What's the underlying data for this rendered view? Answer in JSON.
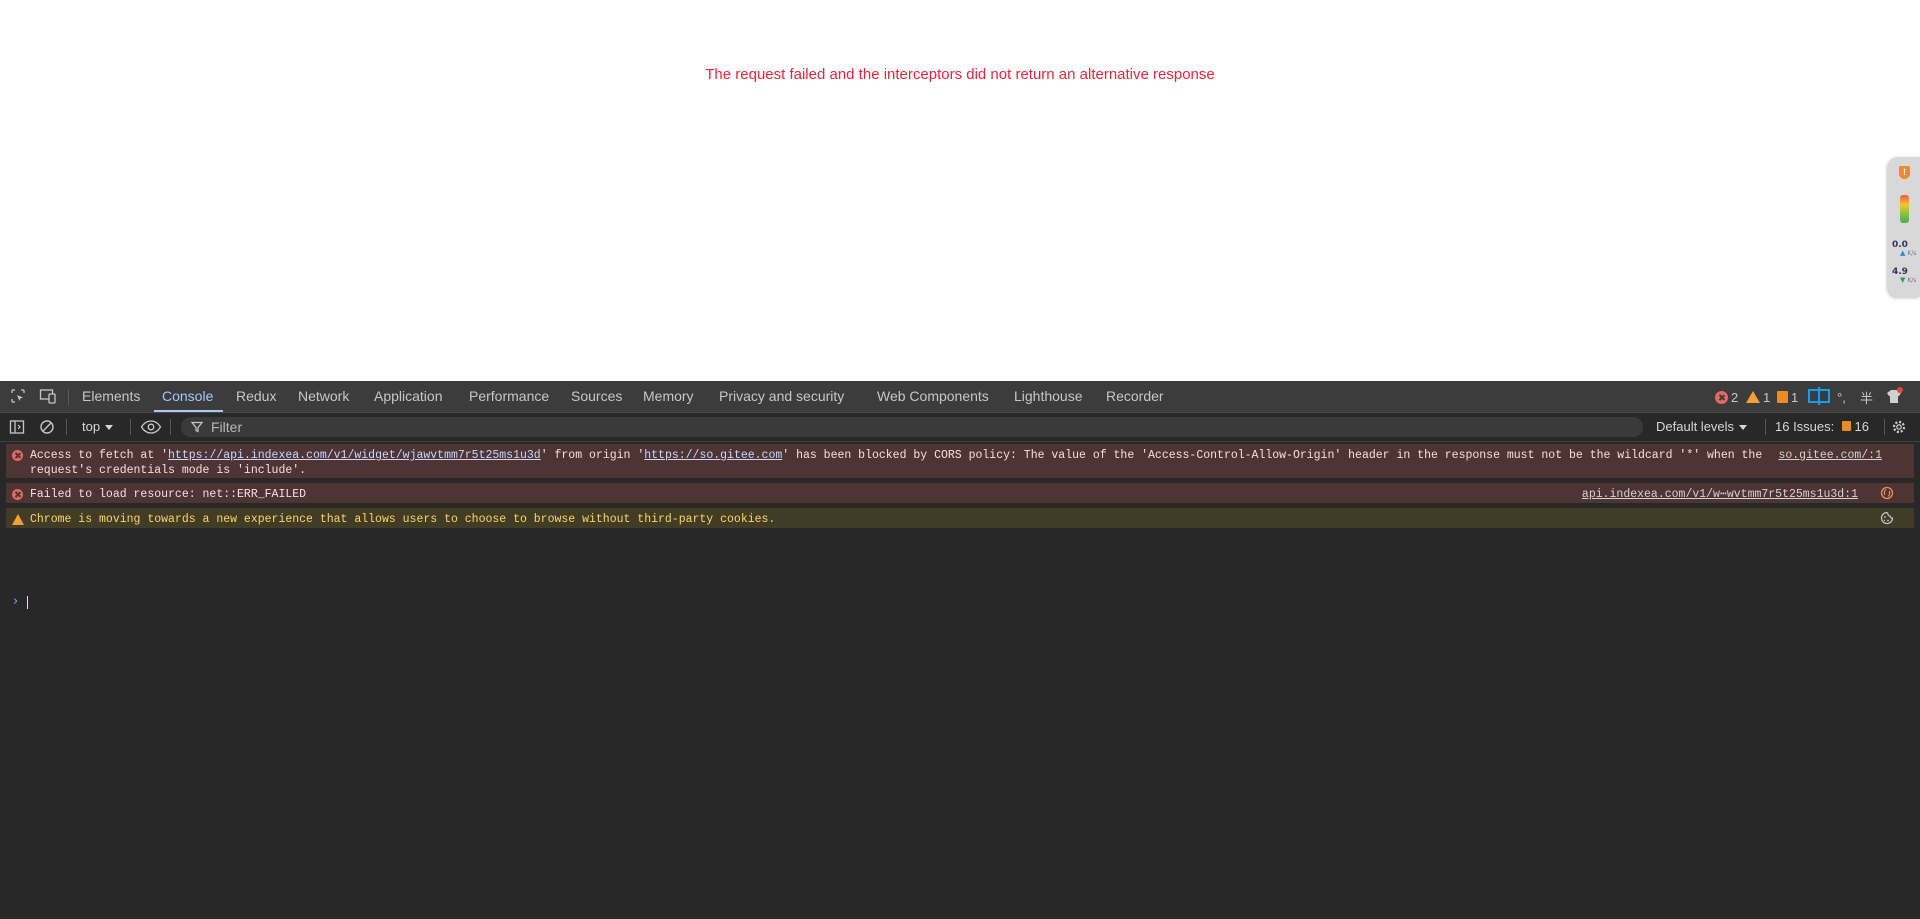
{
  "page": {
    "error_message": "The request failed and the interceptors did not return an alternative response"
  },
  "speed_widget": {
    "badge": "!",
    "upload_value": "0.0",
    "upload_unit": "K/s",
    "download_value": "4.9",
    "download_unit": "K/s"
  },
  "devtools": {
    "tabs": [
      {
        "label": "Elements"
      },
      {
        "label": "Console"
      },
      {
        "label": "Redux"
      },
      {
        "label": "Network"
      },
      {
        "label": "Application"
      },
      {
        "label": "Performance"
      },
      {
        "label": "Sources"
      },
      {
        "label": "Memory"
      },
      {
        "label": "Privacy and security"
      },
      {
        "label": "Web Components"
      },
      {
        "label": "Lighthouse"
      },
      {
        "label": "Recorder"
      }
    ],
    "active_tab": "Console",
    "counts": {
      "errors": "2",
      "warnings": "1",
      "issues": "1"
    },
    "ime_indicators": [
      "°,",
      "半"
    ],
    "toolbar": {
      "context": "top",
      "filter_placeholder": "Filter",
      "levels": "Default levels",
      "issues_label": "16 Issues:",
      "issues_count": "16"
    },
    "messages": [
      {
        "level": "error",
        "prefix": "Access to fetch at '",
        "url1": "https://api.indexea.com/v1/widget/wjawvtmm7r5t25ms1u3d",
        "mid": "' from origin '",
        "url2": "https://so.gitee.com",
        "rest": "' has been blocked by CORS policy: The value of the 'Access-Control-Allow-Origin' header in the response must not be the wildcard '*' when the request's credentials mode is 'include'.",
        "source": "so.gitee.com/:1"
      },
      {
        "level": "error",
        "text": "Failed to load resource: net::ERR_FAILED",
        "source": "api.indexea.com/v1/w⋯wvtmm7r5t25ms1u3d:1"
      },
      {
        "level": "warning",
        "text": "Chrome is moving towards a new experience that allows users to choose to browse without third-party cookies."
      }
    ]
  }
}
